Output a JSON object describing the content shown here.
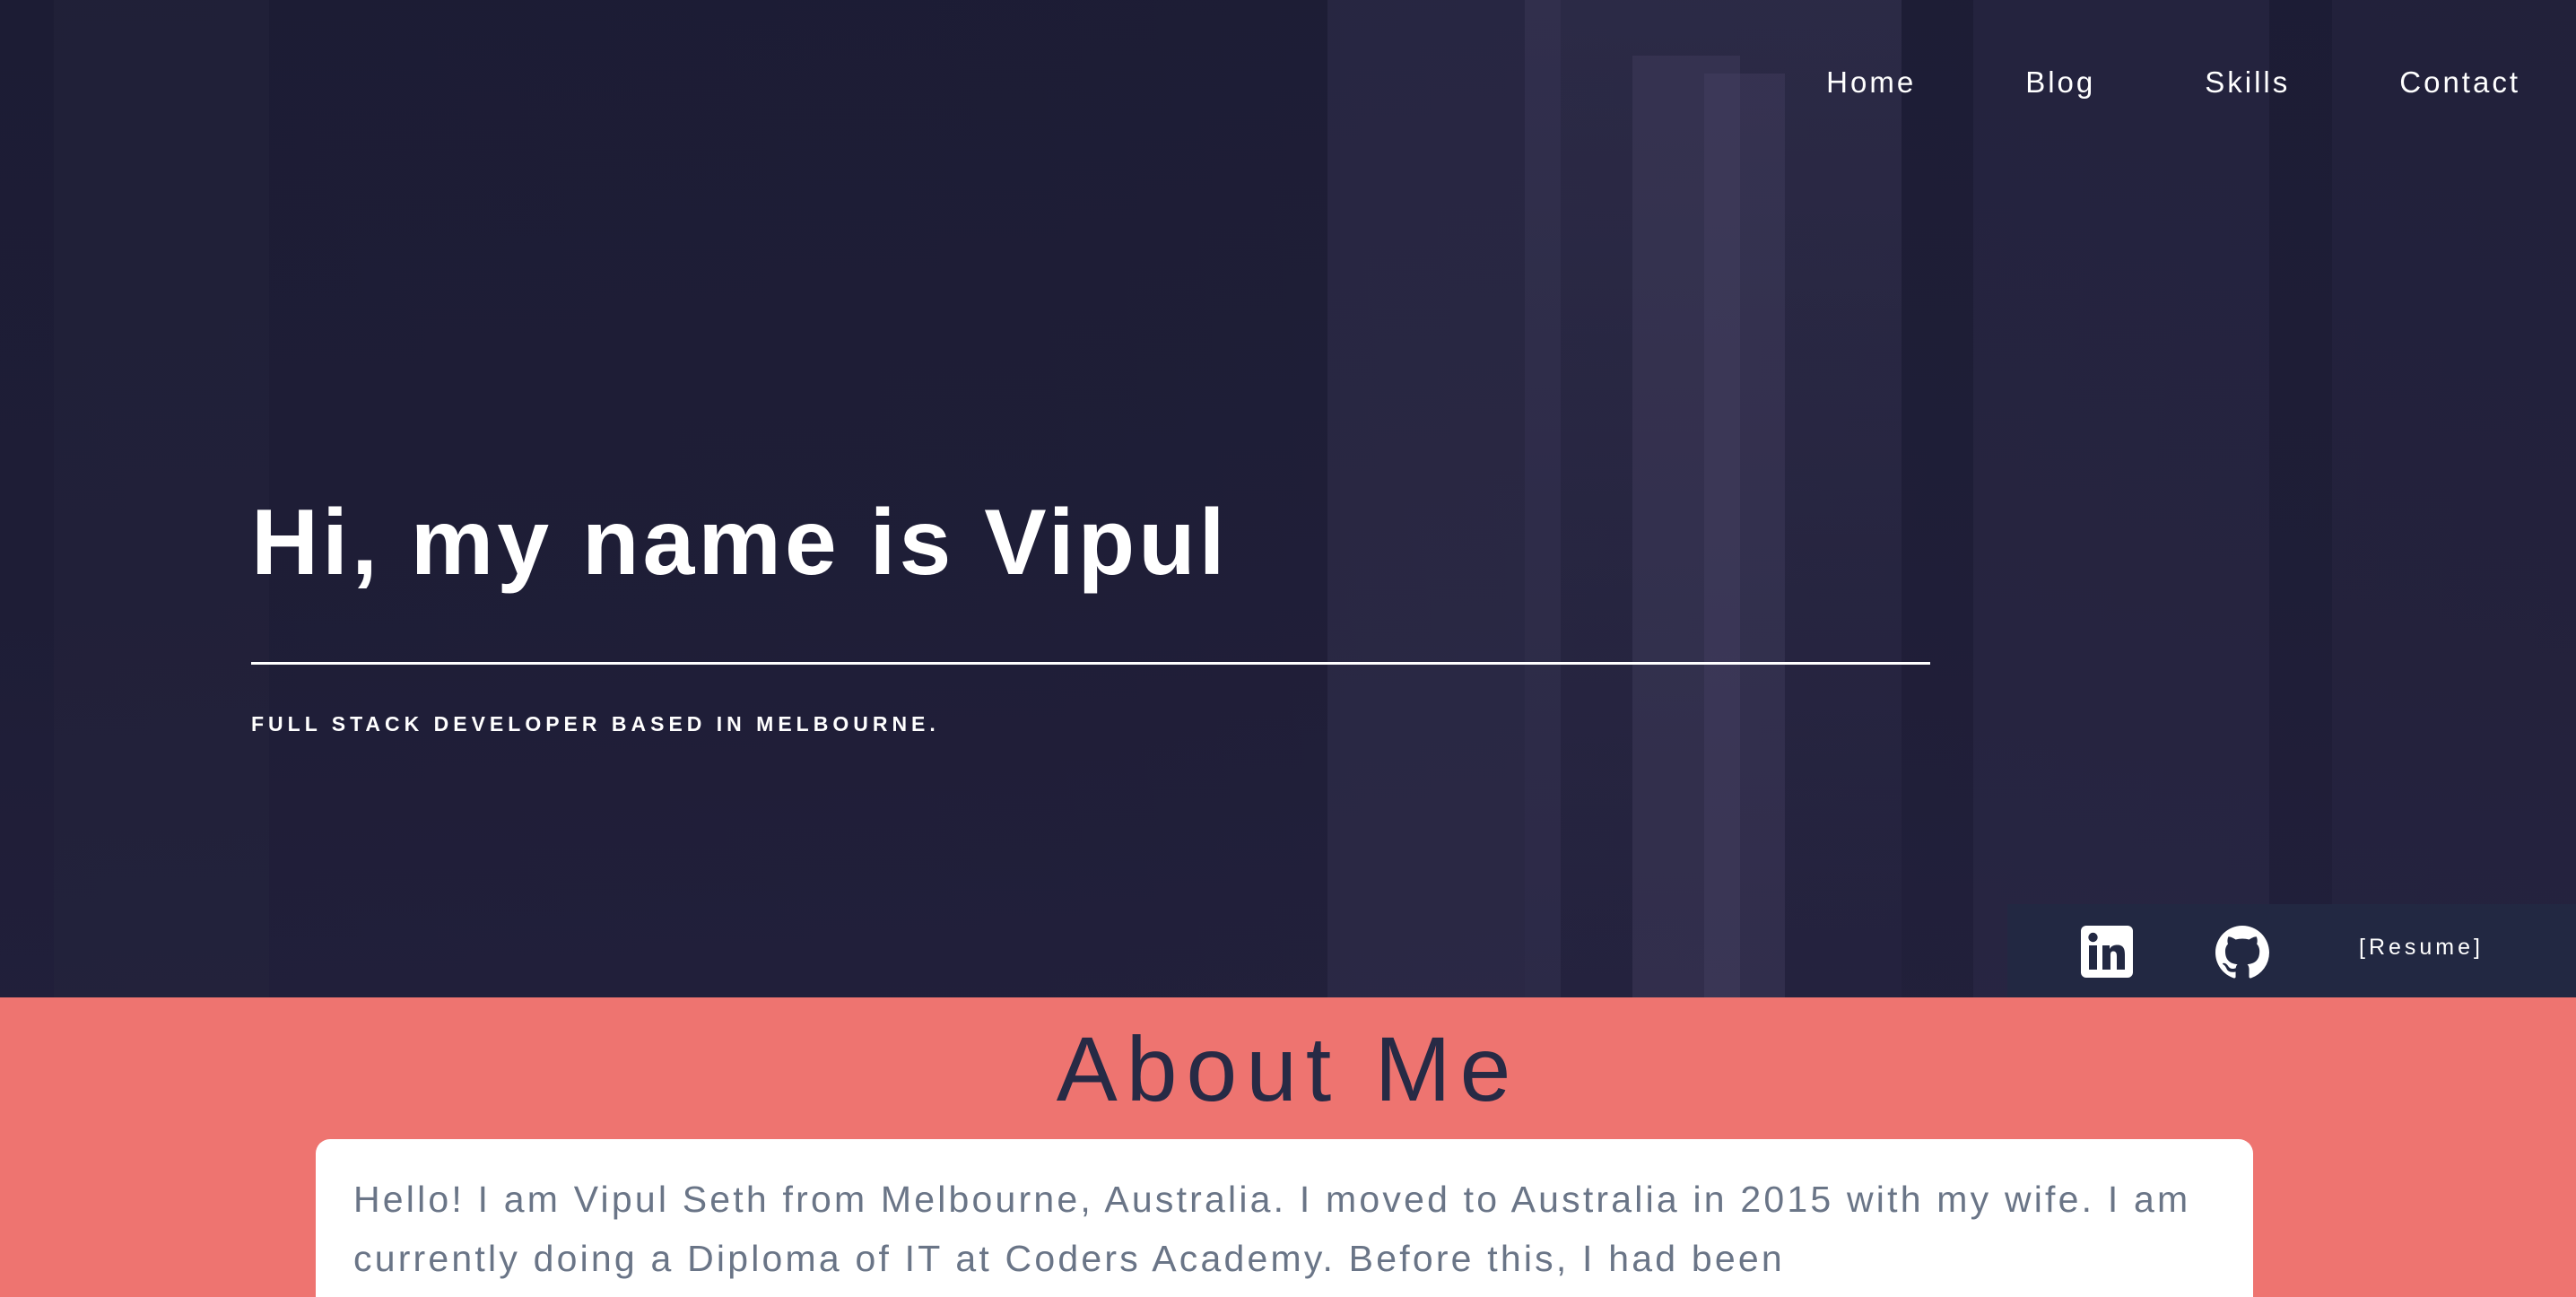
{
  "nav": {
    "items": [
      {
        "label": "Home"
      },
      {
        "label": "Blog"
      },
      {
        "label": "Skills"
      },
      {
        "label": "Contact"
      }
    ]
  },
  "hero": {
    "title": "Hi, my name is Vipul",
    "subtitle": "FULL STACK DEVELOPER BASED IN MELBOURNE."
  },
  "social": {
    "linkedin_icon": "linkedin-icon",
    "github_icon": "github-icon",
    "resume_label": "[Resume]"
  },
  "about": {
    "title": "About Me",
    "text": "Hello! I am Vipul Seth from Melbourne, Australia. I moved to Australia in 2015 with my wife. I am currently doing a Diploma of IT at Coders Academy. Before this, I had been"
  },
  "colors": {
    "hero_bg": "#1e1d36",
    "accent": "#ee7470",
    "social_bar": "#222842",
    "heading_dark": "#272a45",
    "body_text": "#6a7587"
  }
}
